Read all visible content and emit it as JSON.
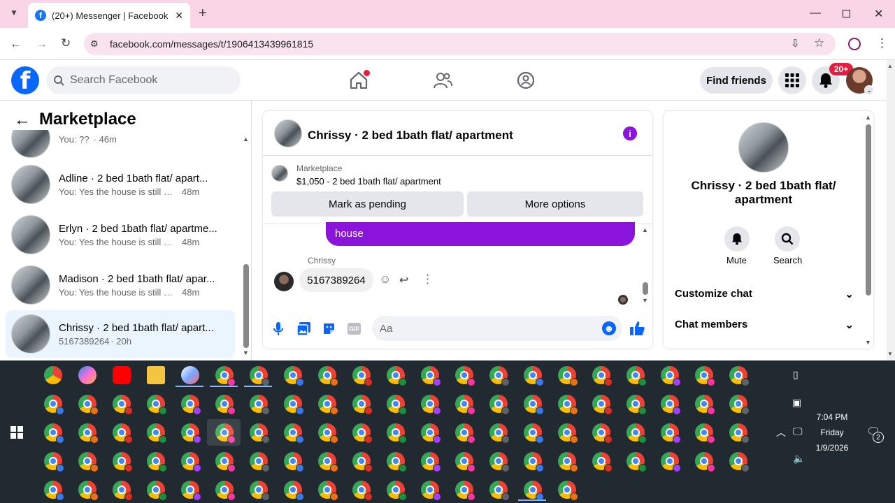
{
  "browser": {
    "tab_title": "(20+) Messenger | Facebook",
    "url": "facebook.com/messages/t/1906413439961815"
  },
  "header": {
    "search_placeholder": "Search Facebook",
    "find_friends": "Find friends",
    "notif_badge": "20+"
  },
  "sidebar": {
    "title": "Marketplace",
    "items": [
      {
        "name": "",
        "preview": "You: ??",
        "time": "· 46m"
      },
      {
        "name": "Adline · 2 bed 1bath flat/ apart...",
        "preview": "You: Yes the house is still availabl...",
        "time": "48m"
      },
      {
        "name": "Erlyn · 2 bed 1bath flat/ apartme...",
        "preview": "You: Yes the house is still availabl...",
        "time": "48m"
      },
      {
        "name": "Madison · 2 bed 1bath flat/ apar...",
        "preview": "You: Yes the house is still availabl...",
        "time": "48m"
      },
      {
        "name": "Chrissy · 2 bed 1bath flat/ apart...",
        "preview": "5167389264",
        "time": "· 20h"
      }
    ]
  },
  "chat": {
    "title": "Chrissy · 2 bed 1bath flat/ apartment",
    "marketplace_label": "Marketplace",
    "listing": "$1,050 - 2 bed 1bath flat/ apartment",
    "mark_pending": "Mark as pending",
    "more_options": "More options",
    "outgoing_tail": "house",
    "sender": "Chrissy",
    "incoming": "5167389264",
    "composer_placeholder": "Aa"
  },
  "details": {
    "name": "Chrissy · 2 bed 1bath flat/ apartment",
    "mute": "Mute",
    "search": "Search",
    "customize": "Customize chat",
    "members": "Chat members"
  },
  "taskbar": {
    "time": "7:04 PM",
    "day": "Friday",
    "date": "1/9/2026",
    "notif_count": "2"
  },
  "colors": {
    "accent": "#8a14d9",
    "fb_blue": "#0866ff",
    "tab_bar": "#f9d5e6"
  }
}
